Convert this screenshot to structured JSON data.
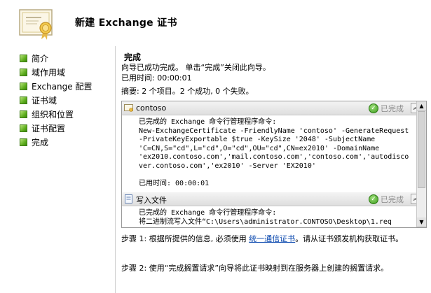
{
  "header": {
    "title": "新建 Exchange 证书"
  },
  "sidebar": {
    "items": [
      {
        "label": "简介"
      },
      {
        "label": "域作用域"
      },
      {
        "label": "Exchange 配置"
      },
      {
        "label": "证书域"
      },
      {
        "label": "组织和位置"
      },
      {
        "label": "证书配置"
      },
      {
        "label": "完成"
      }
    ]
  },
  "main": {
    "section_title": "完成",
    "intro": "向导已成功完成。 单击“完成”关闭此向导。",
    "elapsed": "已用时间: 00:00:01",
    "summary": "摘要: 2 个项目。2 个成功, 0 个失败。",
    "sections": [
      {
        "name": "contoso",
        "status": "已完成",
        "body": "已完成的 Exchange 命令行管理程序命令:\nNew-ExchangeCertificate -FriendlyName 'contoso' -GenerateRequest\n-PrivateKeyExportable $true -KeySize '2048' -SubjectName\n'C=CN,S=\"cd\",L=\"cd\",O=\"cd\",OU=\"cd\",CN=ex2010' -DomainName\n'ex2010.contoso.com','mail.contoso.com','contoso.com','autodisco\nver.contoso.com','ex2010' -Server 'EX2010'\n\n已用时间: 00:00:01"
      },
      {
        "name": "写入文件",
        "status": "已完成",
        "body": "已完成的 Exchange 命令行管理程序命令:\n将二进制流写入文件“C:\\Users\\administrator.CONTOSO\\Desktop\\1.req"
      }
    ],
    "step1_prefix": "步骤 1: 根据所提供的信息, 必须使用 ",
    "step1_link": "统一通信证书",
    "step1_suffix": "。请从证书颁发机构获取证书。",
    "step2": "步骤 2: 使用“完成搁置请求”向导将此证书映射到在服务器上创建的搁置请求。"
  }
}
